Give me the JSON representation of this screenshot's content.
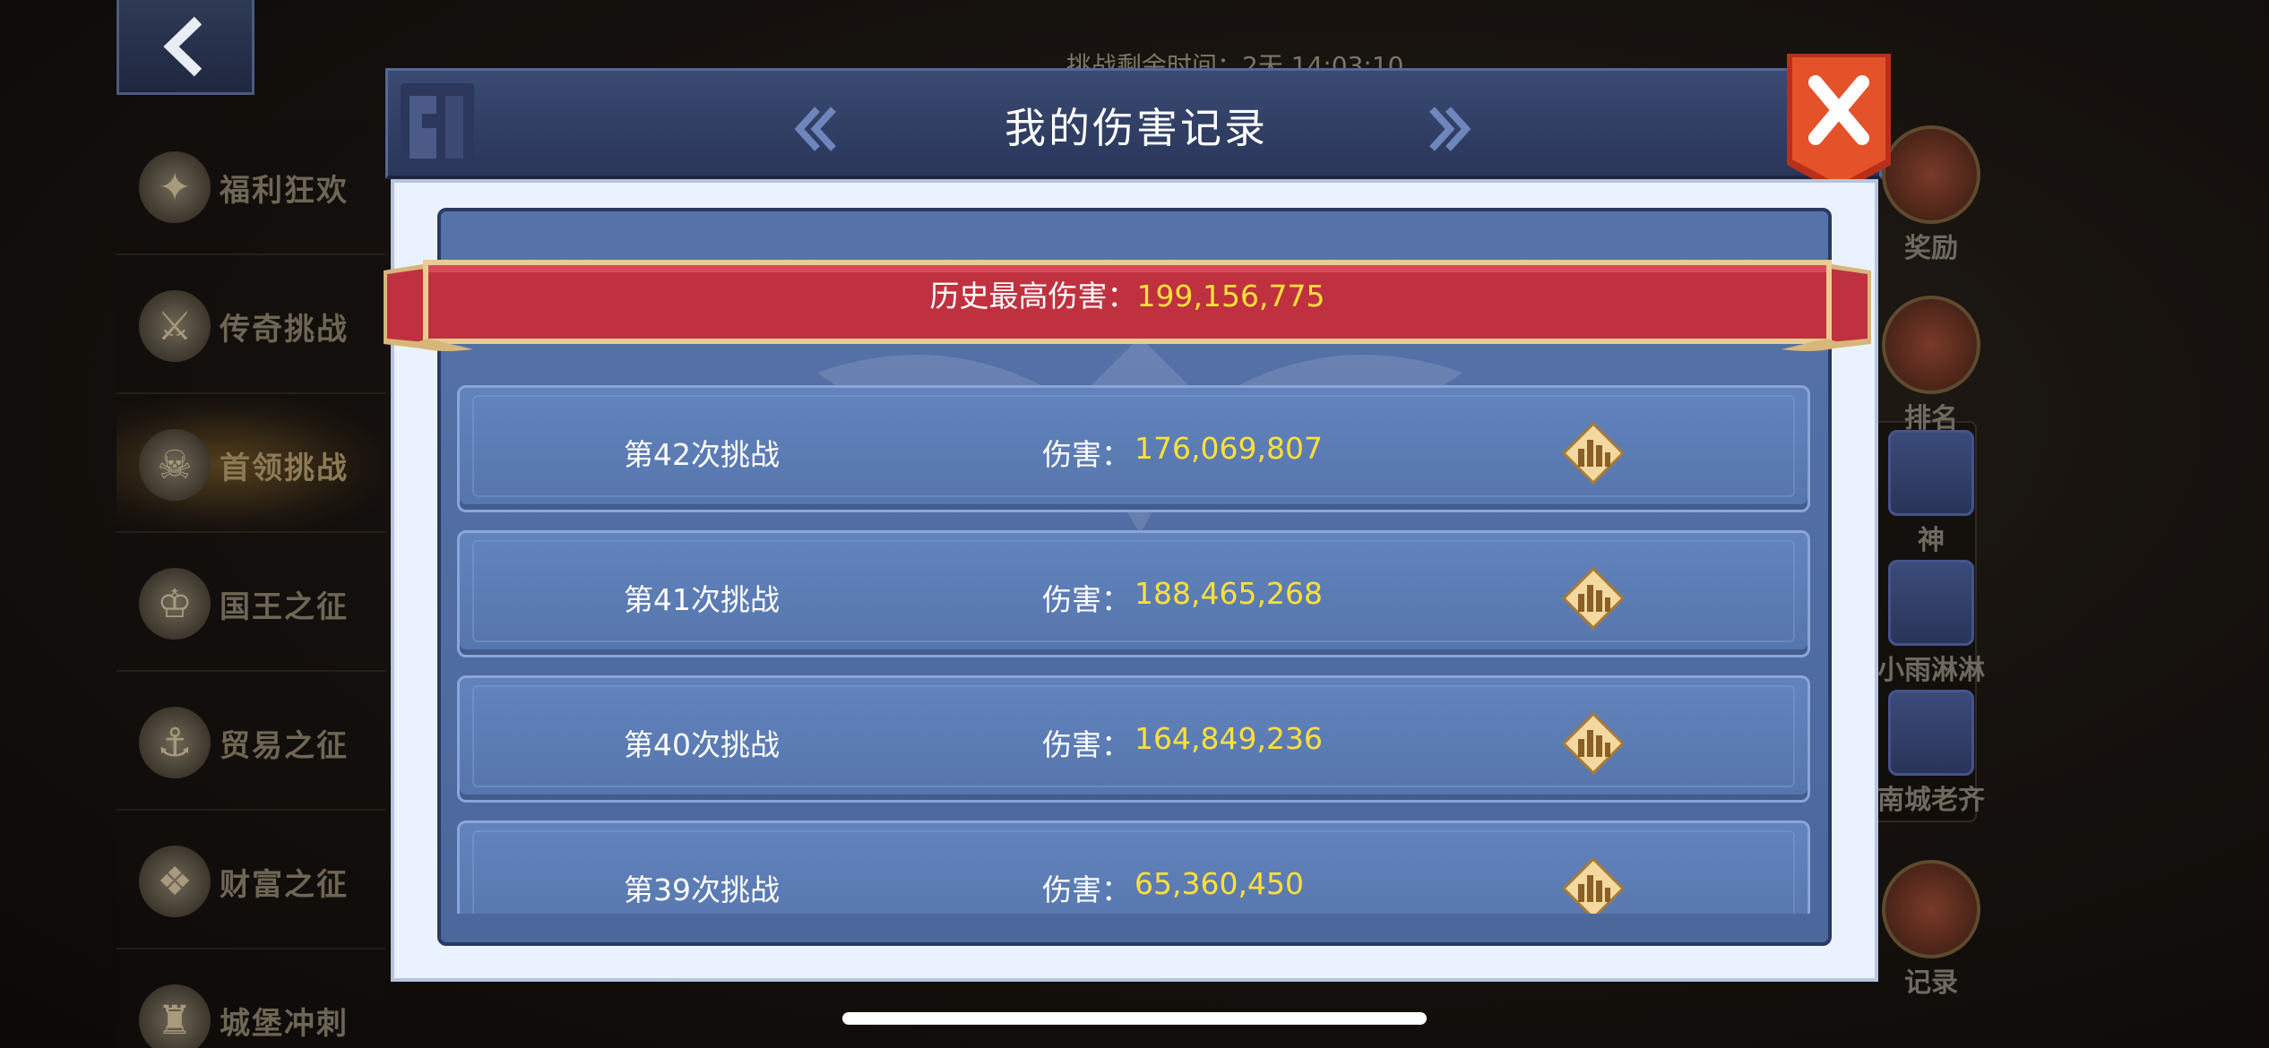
{
  "background": {
    "timer_text": "挑战剩余时间：2天 14:03:10",
    "sidebar_items": [
      {
        "label": "福利狂欢",
        "icon": "festival-icon",
        "glyph": "✦"
      },
      {
        "label": "传奇挑战",
        "icon": "crossed-axes-icon",
        "glyph": "⚔"
      },
      {
        "label": "首领挑战",
        "icon": "demon-skull-icon",
        "glyph": "☠"
      },
      {
        "label": "国王之征",
        "icon": "crown-icon",
        "glyph": "♔"
      },
      {
        "label": "贸易之征",
        "icon": "trade-ship-icon",
        "glyph": "⚓"
      },
      {
        "label": "财富之征",
        "icon": "treasure-chest-icon",
        "glyph": "❖"
      },
      {
        "label": "城堡冲刺",
        "icon": "castle-icon",
        "glyph": "♜"
      }
    ],
    "right_items": {
      "reward": "奖励",
      "ranking": "排名",
      "player1": "神",
      "player2": "小雨淋淋",
      "player3": "南城老齐",
      "record": "记录"
    }
  },
  "modal": {
    "title": "我的伤害记录",
    "best_label": "历史最高伤害：",
    "best_value": "199,156,775",
    "records": [
      {
        "label": "第42次挑战",
        "dmg_label": "伤害：",
        "dmg_value": "176,069,807"
      },
      {
        "label": "第41次挑战",
        "dmg_label": "伤害：",
        "dmg_value": "188,465,268"
      },
      {
        "label": "第40次挑战",
        "dmg_label": "伤害：",
        "dmg_value": "164,849,236"
      },
      {
        "label": "第39次挑战",
        "dmg_label": "伤害：",
        "dmg_value": "65,360,450"
      }
    ]
  },
  "colors": {
    "modal_header": "#2e3b62",
    "panel_blue": "#5673a9",
    "row_blue": "#5e7fb8",
    "value_yellow": "#ffe03a",
    "banner_red": "#c0313f",
    "close_red": "#e2481f"
  }
}
